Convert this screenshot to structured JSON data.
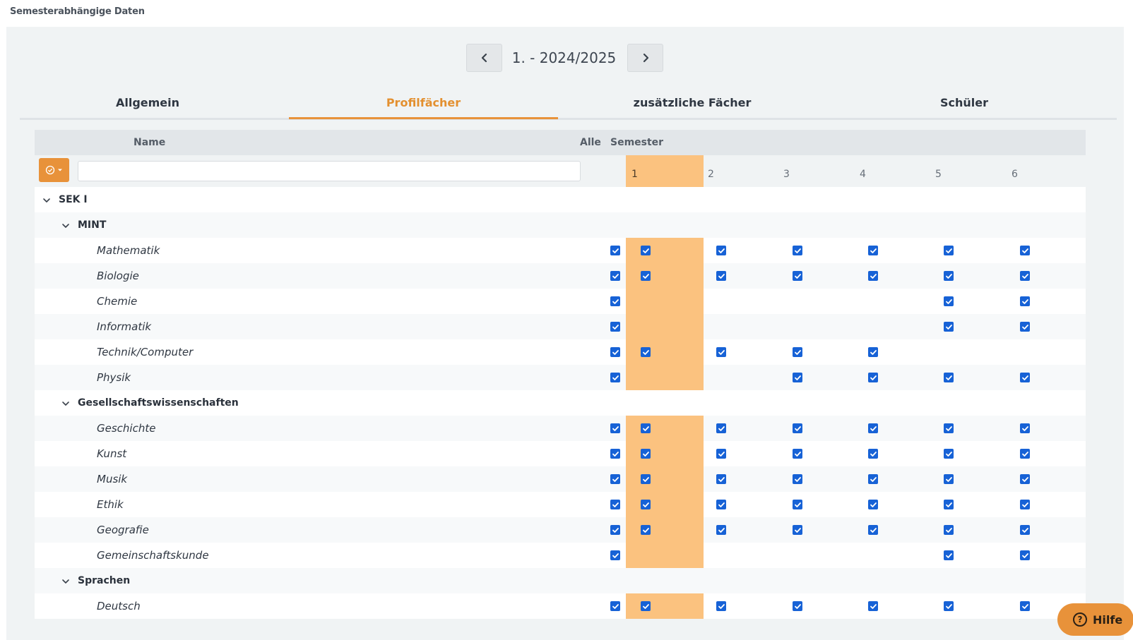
{
  "page": {
    "title": "Semesterabhängige Daten"
  },
  "semester_nav": {
    "label": "1. - 2024/2025"
  },
  "tabs": [
    {
      "label": "Allgemein",
      "active": false
    },
    {
      "label": "Profilfächer",
      "active": true
    },
    {
      "label": "zusätzliche Fächer",
      "active": false
    },
    {
      "label": "Schüler",
      "active": false
    }
  ],
  "table": {
    "headers": {
      "name": "Name",
      "all": "Alle",
      "semester": "Semester"
    },
    "filter": {
      "value": "",
      "placeholder": ""
    },
    "semesters": [
      "1",
      "2",
      "3",
      "4",
      "5",
      "6"
    ],
    "current_semester": "1",
    "rows": [
      {
        "type": "group",
        "level": 0,
        "label": "SEK I"
      },
      {
        "type": "group",
        "level": 1,
        "label": "MINT"
      },
      {
        "type": "item",
        "label": "Mathematik",
        "alle": true,
        "checks": [
          true,
          true,
          true,
          true,
          true,
          true
        ]
      },
      {
        "type": "item",
        "label": "Biologie",
        "alle": true,
        "checks": [
          true,
          true,
          true,
          true,
          true,
          true
        ]
      },
      {
        "type": "item",
        "label": "Chemie",
        "alle": true,
        "checks": [
          false,
          false,
          false,
          false,
          true,
          true
        ]
      },
      {
        "type": "item",
        "label": "Informatik",
        "alle": true,
        "checks": [
          false,
          false,
          false,
          false,
          true,
          true
        ]
      },
      {
        "type": "item",
        "label": "Technik/Computer",
        "alle": true,
        "checks": [
          true,
          true,
          true,
          true,
          false,
          false
        ]
      },
      {
        "type": "item",
        "label": "Physik",
        "alle": true,
        "checks": [
          false,
          false,
          true,
          true,
          true,
          true
        ]
      },
      {
        "type": "group",
        "level": 1,
        "label": "Gesellschaftswissenschaften"
      },
      {
        "type": "item",
        "label": "Geschichte",
        "alle": true,
        "checks": [
          true,
          true,
          true,
          true,
          true,
          true
        ]
      },
      {
        "type": "item",
        "label": "Kunst",
        "alle": true,
        "checks": [
          true,
          true,
          true,
          true,
          true,
          true
        ]
      },
      {
        "type": "item",
        "label": "Musik",
        "alle": true,
        "checks": [
          true,
          true,
          true,
          true,
          true,
          true
        ]
      },
      {
        "type": "item",
        "label": "Ethik",
        "alle": true,
        "checks": [
          true,
          true,
          true,
          true,
          true,
          true
        ]
      },
      {
        "type": "item",
        "label": "Geografie",
        "alle": true,
        "checks": [
          true,
          true,
          true,
          true,
          true,
          true
        ]
      },
      {
        "type": "item",
        "label": "Gemeinschaftskunde",
        "alle": true,
        "checks": [
          false,
          false,
          false,
          false,
          true,
          true
        ]
      },
      {
        "type": "group",
        "level": 1,
        "label": "Sprachen"
      },
      {
        "type": "item",
        "label": "Deutsch",
        "alle": true,
        "checks": [
          true,
          true,
          true,
          true,
          true,
          true
        ]
      }
    ]
  },
  "help": {
    "label": "Hilfe"
  },
  "colors": {
    "accent": "#e8923a",
    "highlight": "#fbc27f",
    "checkbox": "#1762d6"
  }
}
